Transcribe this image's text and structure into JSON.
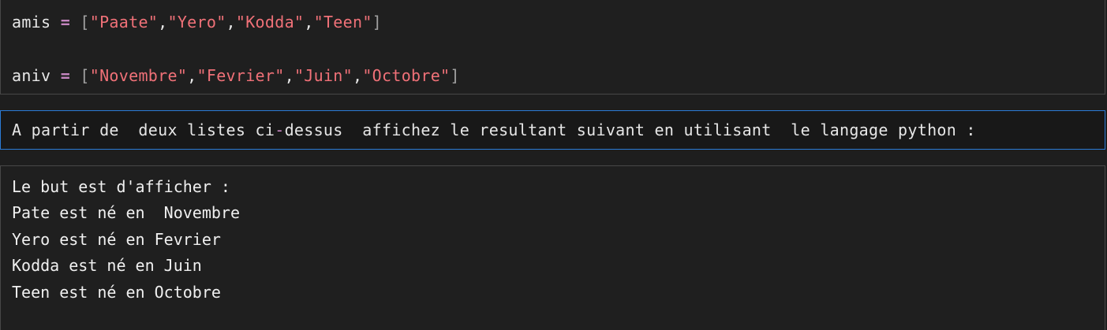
{
  "code_cell": {
    "line1": {
      "var": "amis",
      "op": "=",
      "open": "[",
      "items": [
        "\"Paate\"",
        "\"Yero\"",
        "\"Kodda\"",
        "\"Teen\""
      ],
      "sep": ",",
      "close": "]"
    },
    "line2": {
      "var": "aniv",
      "op": "=",
      "open": "[",
      "items": [
        "\"Novembre\"",
        "\"Fevrier\"",
        "\"Juin\"",
        "\"Octobre\""
      ],
      "sep": ",",
      "close": "]"
    }
  },
  "markdown_cell": {
    "text_before": "A partir de  deux listes ci",
    "hyphen": "-",
    "text_after": "dessus  affichez le resultant suivant en utilisant  le langage python :"
  },
  "output_cell": {
    "lines": [
      "Le but est d'afficher :",
      "Pate est né en  Novembre",
      "Yero est né en Fevrier",
      "Kodda est né en Juin",
      "Teen est né en Octobre"
    ]
  },
  "colors": {
    "background": "#1e1e1e",
    "string": "#f07178",
    "operator": "#c586c0",
    "focus_border": "#2b7bd6"
  }
}
